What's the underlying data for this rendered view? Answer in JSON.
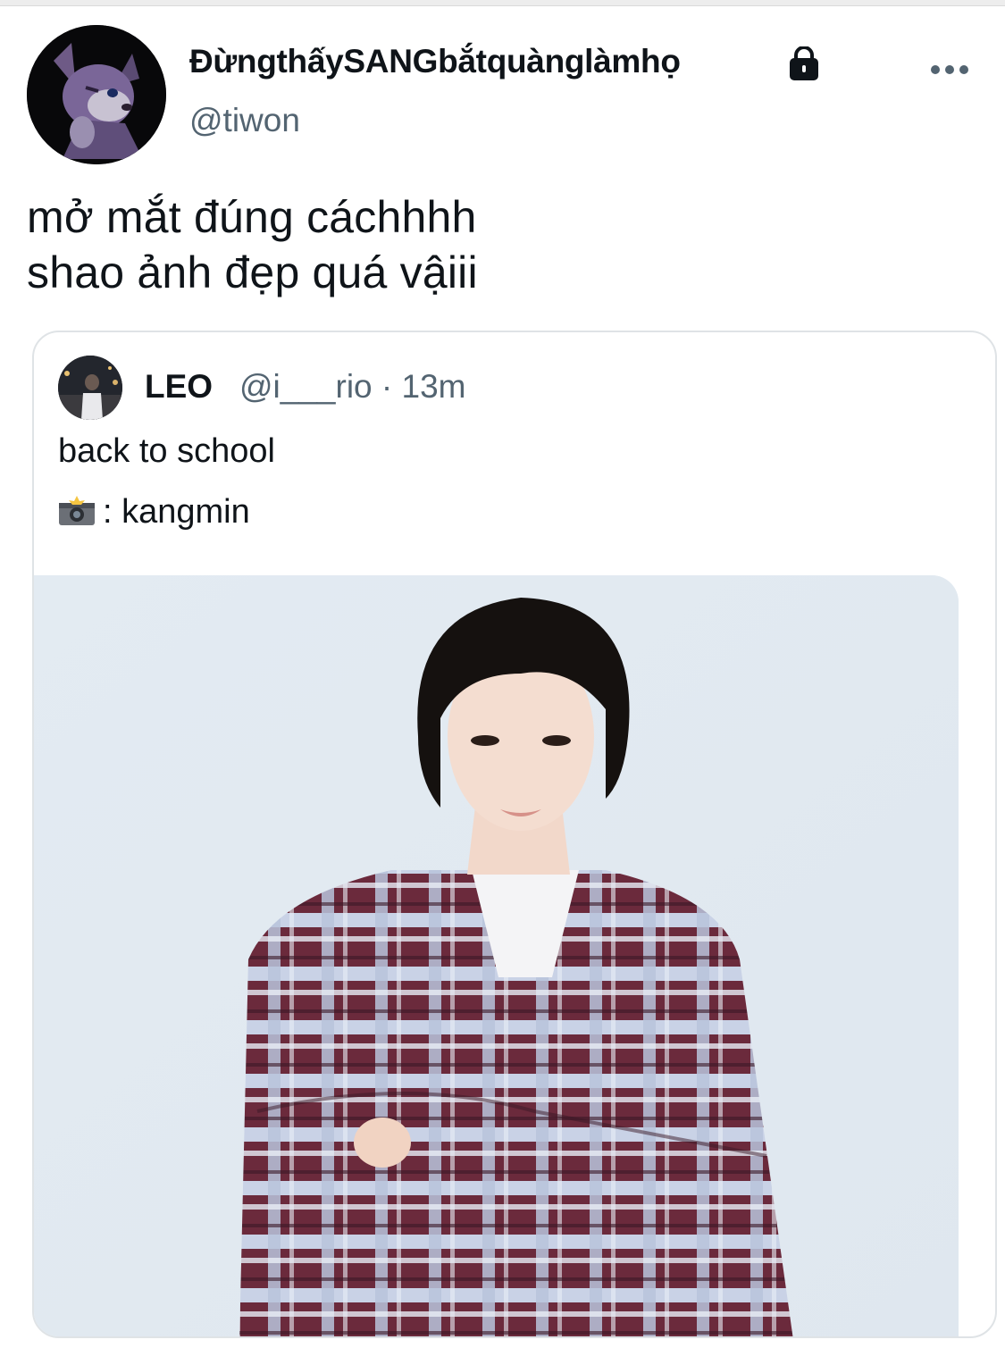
{
  "author": {
    "display_name": "ĐừngthấySANGbắtquànglàmhọ",
    "handle": "@tiwon",
    "avatar_icon": "fox-character-avatar",
    "protected_icon": "lock-icon"
  },
  "tweet": {
    "lines": [
      "mở mắt đúng cáchhhh",
      "shao ảnh đẹp quá vậiii"
    ]
  },
  "menu_icon": "more-horizontal-icon",
  "quoted": {
    "display_name": "LEO",
    "handle": "@i___rio",
    "separator": "·",
    "time": "13m",
    "text_line1": "back to school",
    "text_line2": ": kangmin",
    "camera_icon": "camera-flash-icon"
  },
  "colors": {
    "text": "#0f1419",
    "secondary": "#536471",
    "border": "#dfe3e6"
  }
}
